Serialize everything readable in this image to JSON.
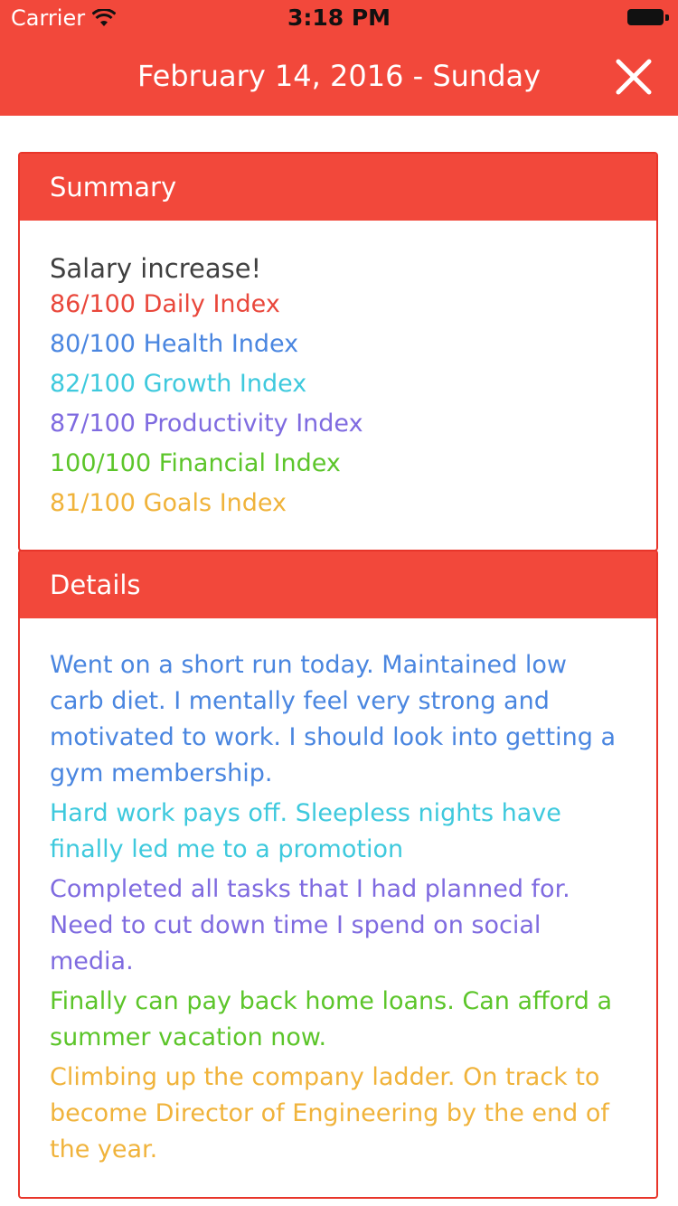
{
  "status_bar": {
    "carrier": "Carrier",
    "time": "3:18 PM",
    "icons": [
      "wifi-icon",
      "battery-icon"
    ]
  },
  "nav": {
    "title": "February 14, 2016 - Sunday",
    "close_icon": "close-icon"
  },
  "colors": {
    "accent": "#f2483b",
    "daily": "#e9473b",
    "health": "#4a86e0",
    "growth": "#3ec9dd",
    "productivity": "#7f6be0",
    "financial": "#5cc52a",
    "goals": "#f0b33b"
  },
  "summary": {
    "header": "Summary",
    "title": "Salary increase!",
    "indices": [
      {
        "text": "86/100 Daily Index",
        "color": "#e9473b"
      },
      {
        "text": "80/100 Health Index",
        "color": "#4a86e0"
      },
      {
        "text": "82/100 Growth Index",
        "color": "#3ec9dd"
      },
      {
        "text": "87/100 Productivity Index",
        "color": "#7f6be0"
      },
      {
        "text": "100/100 Financial Index",
        "color": "#5cc52a"
      },
      {
        "text": "81/100 Goals Index",
        "color": "#f0b33b"
      }
    ]
  },
  "details": {
    "header": "Details",
    "entries": [
      {
        "text": "Went on a short run today. Maintained low carb diet. I mentally feel very strong and motivated to work. I should look into getting a gym membership.",
        "color": "#4a86e0"
      },
      {
        "text": "Hard work pays off. Sleepless nights have finally led me to a promotion",
        "color": "#3ec9dd"
      },
      {
        "text": "Completed all tasks that I had planned for. Need to cut down time I spend on social media.",
        "color": "#7f6be0"
      },
      {
        "text": "Finally can pay back home loans. Can afford a summer vacation now.",
        "color": "#5cc52a"
      },
      {
        "text": "Climbing up the company ladder. On track to become Director of Engineering by the end of the year.",
        "color": "#f0b33b"
      }
    ]
  }
}
